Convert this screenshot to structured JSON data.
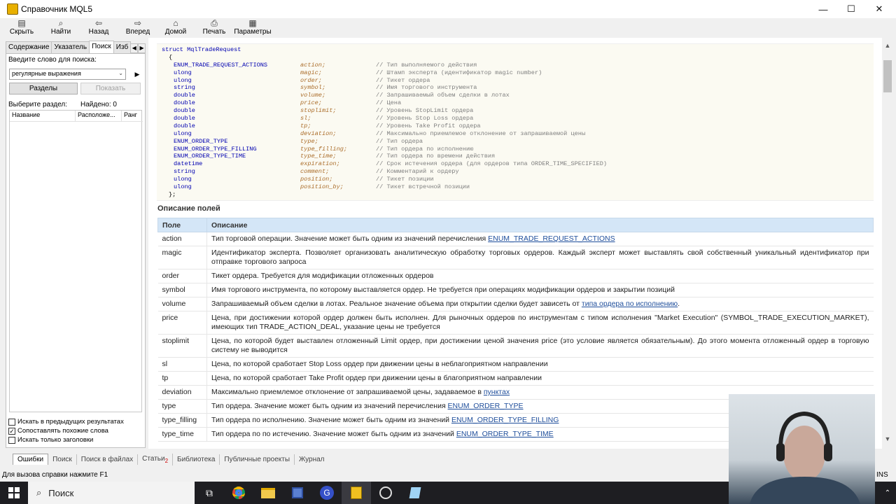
{
  "window": {
    "title": "Справочник MQL5",
    "minimize": "—",
    "maximize": "☐",
    "close": "✕"
  },
  "toolbar": {
    "hide": "Скрыть",
    "find": "Найти",
    "back": "Назад",
    "forward": "Вперед",
    "home": "Домой",
    "print": "Печать",
    "options": "Параметры"
  },
  "sidebar": {
    "tabs": [
      "Содержание",
      "Указатель",
      "Поиск",
      "Изб"
    ],
    "search_prompt": "Введите слово для поиска:",
    "search_mode": "регулярные выражения",
    "sections_button": "Разделы",
    "show_button": "Показать",
    "select_section": "Выберите раздел:",
    "found": "Найдено: 0",
    "columns": [
      "Название",
      "Расположе...",
      "Ранг"
    ],
    "checkboxes": [
      {
        "label": "Искать в предыдущих результатах",
        "checked": false
      },
      {
        "label": "Сопоставлять похожие слова",
        "checked": true
      },
      {
        "label": "Искать только заголовки",
        "checked": false
      }
    ]
  },
  "code": {
    "header": "struct MqlTradeRequest",
    "open": "{",
    "close": "};",
    "lines": [
      {
        "type": "ENUM_TRADE_REQUEST_ACTIONS",
        "field": "action;",
        "comment": "// Тип выполняемого действия"
      },
      {
        "type": "ulong",
        "field": "magic;",
        "comment": "// Штамп эксперта (идентификатор magic number)"
      },
      {
        "type": "ulong",
        "field": "order;",
        "comment": "// Тикет ордера"
      },
      {
        "type": "string",
        "field": "symbol;",
        "comment": "// Имя торгового инструмента"
      },
      {
        "type": "double",
        "field": "volume;",
        "comment": "// Запрашиваемый объем сделки в лотах"
      },
      {
        "type": "double",
        "field": "price;",
        "comment": "// Цена"
      },
      {
        "type": "double",
        "field": "stoplimit;",
        "comment": "// Уровень StopLimit ордера"
      },
      {
        "type": "double",
        "field": "sl;",
        "comment": "// Уровень Stop Loss ордера"
      },
      {
        "type": "double",
        "field": "tp;",
        "comment": "// Уровень Take Profit ордера"
      },
      {
        "type": "ulong",
        "field": "deviation;",
        "comment": "// Максимально приемлемое отклонение от запрашиваемой цены"
      },
      {
        "type": "ENUM_ORDER_TYPE",
        "field": "type;",
        "comment": "// Тип ордера"
      },
      {
        "type": "ENUM_ORDER_TYPE_FILLING",
        "field": "type_filling;",
        "comment": "// Тип ордера по исполнению"
      },
      {
        "type": "ENUM_ORDER_TYPE_TIME",
        "field": "type_time;",
        "comment": "// Тип ордера по времени действия"
      },
      {
        "type": "datetime",
        "field": "expiration;",
        "comment": "// Срок истечения ордера (для ордеров типа ORDER_TIME_SPECIFIED)"
      },
      {
        "type": "string",
        "field": "comment;",
        "comment": "// Комментарий к ордеру"
      },
      {
        "type": "ulong",
        "field": "position;",
        "comment": "// Тикет позиции"
      },
      {
        "type": "ulong",
        "field": "position_by;",
        "comment": "// Тикет встречной позиции"
      }
    ]
  },
  "fields_section": {
    "title": "Описание полей",
    "col_field": "Поле",
    "col_desc": "Описание",
    "rows": [
      {
        "name": "action",
        "desc": "Тип торговой операции. Значение может быть одним из значений перечисления ",
        "link": "ENUM_TRADE_REQUEST_ACTIONS",
        "tail": ""
      },
      {
        "name": "magic",
        "desc": "Идентификатор эксперта. Позволяет организовать аналитическую обработку торговых ордеров. Каждый эксперт может выставлять свой собственный уникальный идентификатор при отправке торгового запроса",
        "link": "",
        "tail": ""
      },
      {
        "name": "order",
        "desc": "Тикет ордера. Требуется для модификации отложенных ордеров",
        "link": "",
        "tail": ""
      },
      {
        "name": "symbol",
        "desc": "Имя торгового инструмента, по которому выставляется ордер. Не требуется при операциях модификации ордеров и закрытии позиций",
        "link": "",
        "tail": ""
      },
      {
        "name": "volume",
        "desc": "Запрашиваемый объем сделки в лотах. Реальное значение объема при открытии сделки будет зависеть от ",
        "link": "типа ордера по исполнению",
        "tail": "."
      },
      {
        "name": "price",
        "desc": "Цена, при достижении которой ордер должен быть исполнен. Для рыночных ордеров по инструментам с типом исполнения \"Market Execution\" (SYMBOL_TRADE_EXECUTION_MARKET), имеющих тип TRADE_ACTION_DEAL, указание цены не требуется",
        "link": "",
        "tail": ""
      },
      {
        "name": "stoplimit",
        "desc": "Цена, по которой будет выставлен отложенный Limit ордер, при достижении ценой значения price (это условие является обязательным). До этого момента отложенный ордер в торговую систему не выводится",
        "link": "",
        "tail": ""
      },
      {
        "name": "sl",
        "desc": "Цена, по которой сработает Stop Loss ордер при движении цены в неблагоприятном направлении",
        "link": "",
        "tail": ""
      },
      {
        "name": "tp",
        "desc": "Цена, по которой сработает Take Profit ордер при движении цены в благоприятном направлении",
        "link": "",
        "tail": ""
      },
      {
        "name": "deviation",
        "desc": "Максимально приемлемое отклонение от запрашиваемой цены, задаваемое в ",
        "link": "пунктах",
        "tail": ""
      },
      {
        "name": "type",
        "desc": "Тип ордера. Значение может быть одним из значений перечисления ",
        "link": "ENUM_ORDER_TYPE",
        "tail": ""
      },
      {
        "name": "type_filling",
        "desc": "Тип ордера по исполнению. Значение может быть одним из значений ",
        "link": "ENUM_ORDER_TYPE_FILLING",
        "tail": ""
      },
      {
        "name": "type_time",
        "desc": "Тип ордера по по истечению. Значение может быть одним из значений ",
        "link": "ENUM_ORDER_TYPE_TIME",
        "tail": ""
      }
    ]
  },
  "bottom_tabs": [
    "Ошибки",
    "Поиск",
    "Поиск в файлах",
    "Статьи",
    "Библиотека",
    "Публичные проекты",
    "Журнал"
  ],
  "articles_badge": "2",
  "status": {
    "text": "Для вызова справки нажмите F1",
    "right": "INS"
  },
  "taskbar": {
    "search": "Поиск"
  }
}
